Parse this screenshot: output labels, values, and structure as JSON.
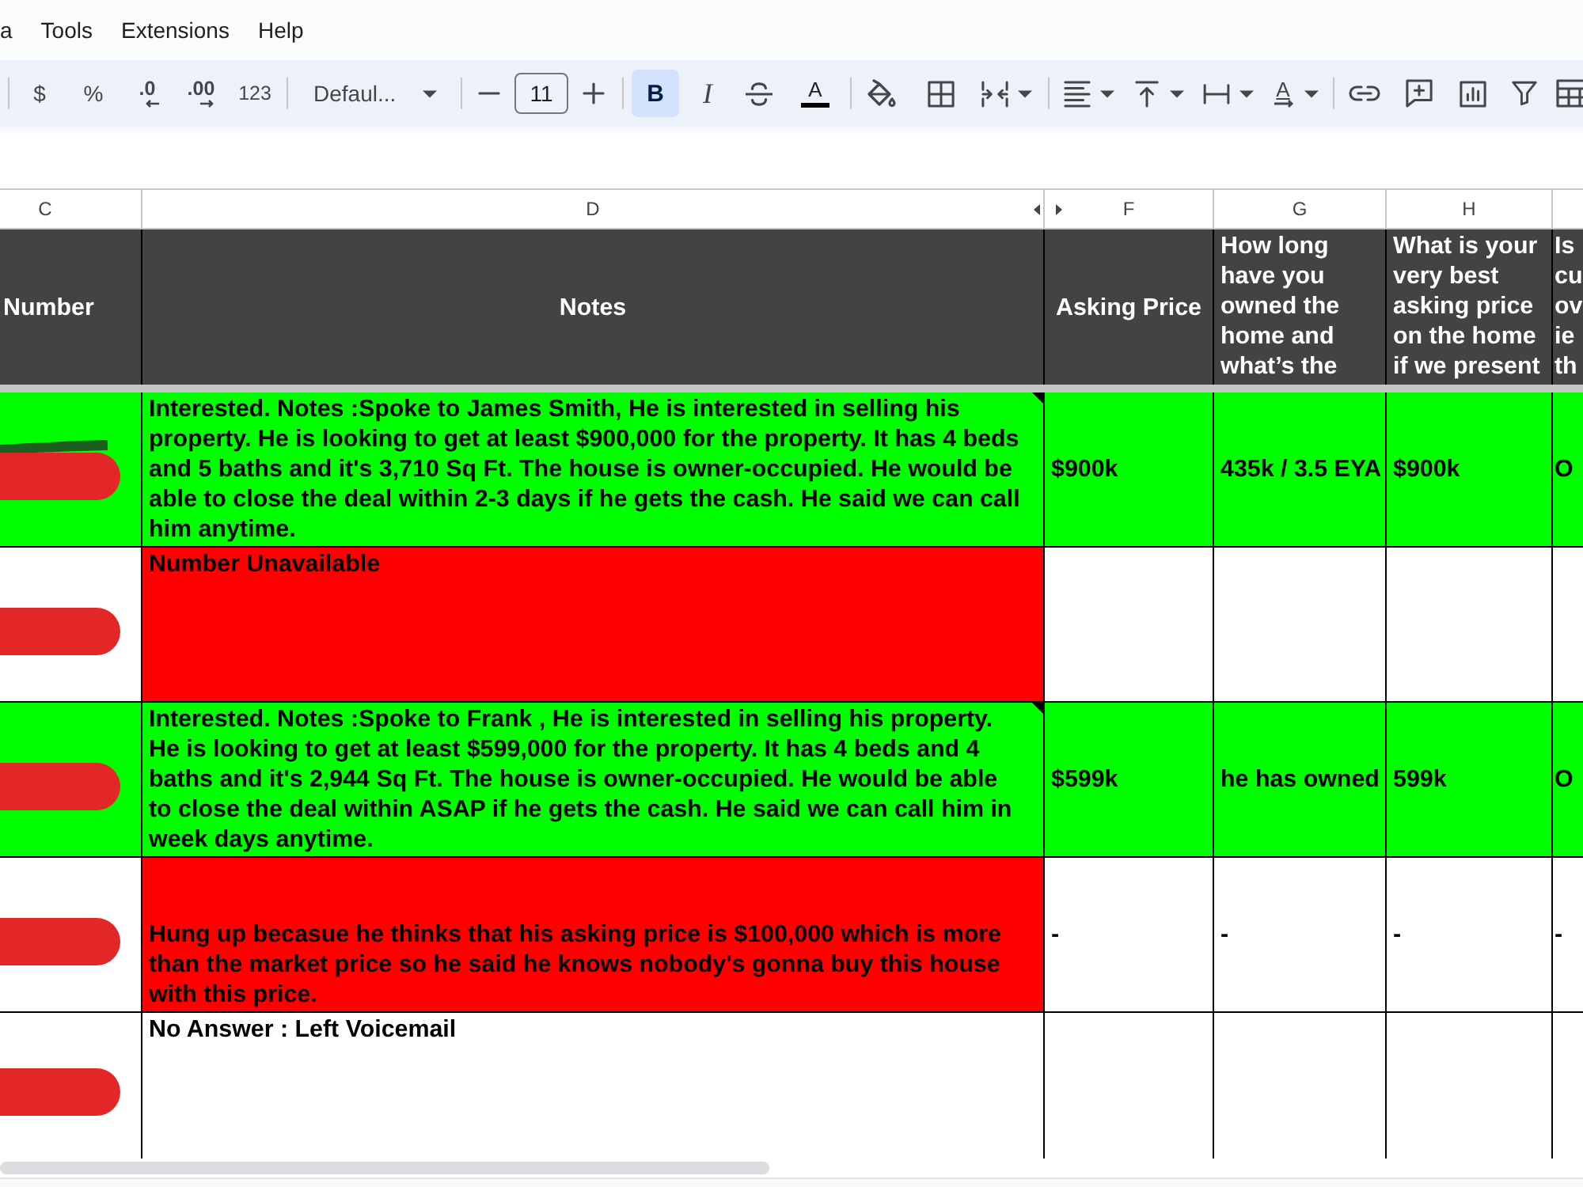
{
  "menu": [
    "a",
    "Tools",
    "Extensions",
    "Help"
  ],
  "toolbar": [
    {
      "kind": "separator"
    },
    {
      "kind": "currency",
      "label": "$"
    },
    {
      "kind": "percent",
      "label": "%"
    },
    {
      "kind": "decimal-decrease",
      "label": ".0"
    },
    {
      "kind": "decimal-increase",
      "label": ".00"
    },
    {
      "kind": "number-format",
      "label": "123"
    },
    {
      "kind": "separator"
    },
    {
      "kind": "font",
      "label": "Defaul..."
    },
    {
      "kind": "separator"
    },
    {
      "kind": "minus"
    },
    {
      "kind": "size",
      "label": "11"
    },
    {
      "kind": "plus"
    },
    {
      "kind": "separator"
    },
    {
      "kind": "bold",
      "label": "B",
      "selected": true
    },
    {
      "kind": "italic",
      "label": "I",
      "selected": false
    },
    {
      "kind": "strikethrough",
      "selected": false
    },
    {
      "kind": "text-color",
      "label": "A"
    },
    {
      "kind": "separator"
    },
    {
      "kind": "fill-color"
    },
    {
      "kind": "borders"
    },
    {
      "kind": "merge"
    },
    {
      "kind": "separator"
    },
    {
      "kind": "align"
    },
    {
      "kind": "valign"
    },
    {
      "kind": "wrap"
    },
    {
      "kind": "rotate",
      "label": "A"
    },
    {
      "kind": "separator"
    },
    {
      "kind": "link"
    },
    {
      "kind": "comment"
    },
    {
      "kind": "chart"
    },
    {
      "kind": "filter"
    },
    {
      "kind": "table"
    }
  ],
  "columns": [
    {
      "letter": "C",
      "hidden_before": false,
      "hidden_after": false
    },
    {
      "letter": "D",
      "hidden_before": false,
      "hidden_after": true
    },
    {
      "letter": "F",
      "hidden_before": true,
      "hidden_after": false
    },
    {
      "letter": "G",
      "hidden_before": false,
      "hidden_after": false
    },
    {
      "letter": "H",
      "hidden_before": false,
      "hidden_after": false
    }
  ],
  "header": [
    {
      "kind": "label",
      "text": "Number"
    },
    {
      "kind": "title",
      "text": "Notes"
    },
    {
      "kind": "title",
      "text": "Asking Price"
    },
    {
      "kind": "question",
      "text": "How long have you owned the home and what’s the"
    },
    {
      "kind": "question",
      "text": "What is your very best asking price on the home if we present"
    },
    {
      "kind": "question",
      "text": "Is cu ov ie th"
    }
  ],
  "rows": [
    {
      "kind": "row",
      "color": "#00ff00",
      "redacted": true,
      "scribble": true,
      "note_marker": true,
      "text_at_bottom": false,
      "notes": "Interested. Notes :Spoke to James Smith, He is interested in selling his property. He is looking to get at least $900,000 for the property. It has 4 beds and 5 baths and it's 3,710 Sq Ft. The house is owner-occupied. He would be able to close the deal within 2-3 days if he gets the cash. He said we can call him anytime.",
      "cells": [
        "$900k",
        "435k / 3.5 EYA",
        "$900k",
        "O"
      ]
    },
    {
      "kind": "note",
      "color": "#ff0000",
      "redacted": true,
      "scribble": false,
      "note_marker": false,
      "text_at_bottom": false,
      "notes": "Number Unavailable"
    },
    {
      "kind": "row",
      "color": "#00ff00",
      "redacted": true,
      "scribble": false,
      "note_marker": true,
      "text_at_bottom": false,
      "notes": "Interested. Notes :Spoke to Frank , He is interested in selling his property. He is looking to get at least $599,000 for the property. It has 4 beds and 4 baths and it's 2,944 Sq Ft. The house is owner-occupied. He would be able to close the deal within ASAP if he gets the cash. He said we can call him in week days anytime.",
      "cells": [
        "$599k",
        "he has owned",
        "599k",
        "O"
      ]
    },
    {
      "kind": "note",
      "color": "#ff0000",
      "redacted": true,
      "scribble": false,
      "note_marker": false,
      "text_at_bottom": true,
      "notes": "Hung up becasue he thinks that his asking price is $100,000 which is more than the market price so he said he knows nobody's gonna buy this house with this price.",
      "cells": [
        "-",
        "-",
        "-",
        "-"
      ]
    },
    {
      "kind": "plain",
      "redacted": true,
      "scribble": false,
      "note_marker": false,
      "text_at_bottom": false,
      "notes": "No Answer : Left Voicemail"
    }
  ]
}
